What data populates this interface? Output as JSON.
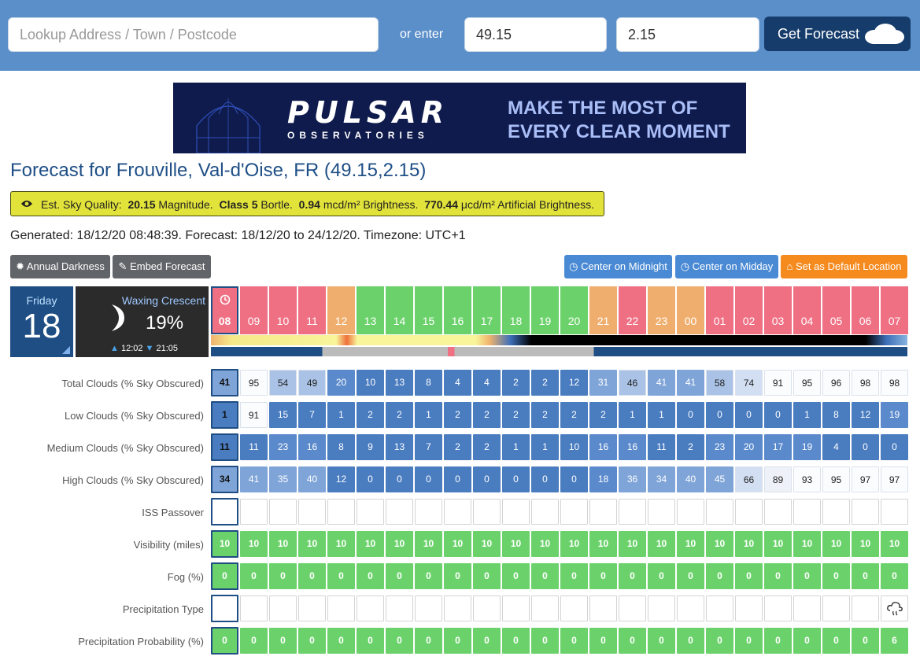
{
  "search": {
    "placeholder": "Lookup Address / Town / Postcode",
    "or_label": "or enter",
    "lat": "49.15",
    "lng": "2.15",
    "button_label": "Get Forecast"
  },
  "ad": {
    "brand": "PULSAR",
    "brand_sub": "OBSERVATORIES",
    "tagline_1": "MAKE THE MOST OF",
    "tagline_2": "EVERY CLEAR MOMENT"
  },
  "title": "Forecast for Frouville, Val-d'Oise, FR (49.15,2.15)",
  "sky_quality": {
    "label": "Est. Sky Quality:",
    "magnitude": "20.15",
    "magnitude_unit": "Magnitude.",
    "class": "Class 5",
    "bortle": "Bortle.",
    "brightness": "0.94",
    "brightness_unit": "mcd/m² Brightness.",
    "artificial": "770.44",
    "artificial_unit": "μcd/m² Artificial Brightness."
  },
  "generated": "Generated: 18/12/20 08:48:39. Forecast: 18/12/20 to 24/12/20. Timezone: UTC+1",
  "buttons": {
    "annual_darkness": "Annual Darkness",
    "embed": "Embed Forecast",
    "midnight": "Center on Midnight",
    "midday": "Center on Midday",
    "default_location": "Set as Default Location"
  },
  "day": {
    "name": "Friday",
    "date": "18"
  },
  "moon": {
    "phase": "Waxing Crescent",
    "illumination": "19%",
    "rise": "12:02",
    "set": "21:05"
  },
  "hours": [
    "08",
    "09",
    "10",
    "11",
    "12",
    "13",
    "14",
    "15",
    "16",
    "17",
    "18",
    "19",
    "20",
    "21",
    "22",
    "23",
    "00",
    "01",
    "02",
    "03",
    "04",
    "05",
    "06",
    "07"
  ],
  "hour_colors": [
    "#ef6f83",
    "#ef6f83",
    "#ef6f83",
    "#ef6f83",
    "#f0ae6e",
    "#6bd26b",
    "#6bd26b",
    "#6bd26b",
    "#6bd26b",
    "#6bd26b",
    "#6bd26b",
    "#6bd26b",
    "#6bd26b",
    "#f0ae6e",
    "#ef6f83",
    "#f0ae6e",
    "#f0ae6e",
    "#ef6f83",
    "#ef6f83",
    "#ef6f83",
    "#ef6f83",
    "#ef6f83",
    "#ef6f83",
    "#ef6f83"
  ],
  "rows": [
    {
      "label": "Total Clouds (% Sky Obscured)",
      "kind": "cloud",
      "first": "41",
      "values": [
        "95",
        "54",
        "49",
        "20",
        "10",
        "13",
        "8",
        "4",
        "4",
        "2",
        "2",
        "12",
        "31",
        "46",
        "41",
        "41",
        "58",
        "74",
        "91",
        "95",
        "96",
        "98",
        "98"
      ]
    },
    {
      "label": "Low Clouds (% Sky Obscured)",
      "kind": "cloud",
      "first": "1",
      "values": [
        "91",
        "15",
        "7",
        "1",
        "2",
        "2",
        "1",
        "2",
        "2",
        "2",
        "2",
        "2",
        "2",
        "1",
        "1",
        "0",
        "0",
        "0",
        "0",
        "1",
        "8",
        "12",
        "19"
      ]
    },
    {
      "label": "Medium Clouds (% Sky Obscured)",
      "kind": "cloud",
      "first": "11",
      "values": [
        "11",
        "23",
        "16",
        "8",
        "9",
        "13",
        "7",
        "2",
        "2",
        "1",
        "1",
        "10",
        "16",
        "16",
        "11",
        "2",
        "23",
        "20",
        "17",
        "19",
        "4",
        "0",
        "0"
      ]
    },
    {
      "label": "High Clouds (% Sky Obscured)",
      "kind": "cloud",
      "first": "34",
      "values": [
        "41",
        "35",
        "40",
        "12",
        "0",
        "0",
        "0",
        "0",
        "0",
        "0",
        "0",
        "0",
        "18",
        "36",
        "34",
        "40",
        "45",
        "66",
        "89",
        "93",
        "95",
        "97",
        "97"
      ]
    },
    {
      "label": "ISS Passover",
      "kind": "empty",
      "first": "",
      "values": [
        "",
        "",
        "",
        "",
        "",
        "",
        "",
        "",
        "",
        "",
        "",
        "",
        "",
        "",
        "",
        "",
        "",
        "",
        "",
        "",
        "",
        "",
        ""
      ]
    },
    {
      "label": "Visibility (miles)",
      "kind": "green",
      "first": "10",
      "values": [
        "10",
        "10",
        "10",
        "10",
        "10",
        "10",
        "10",
        "10",
        "10",
        "10",
        "10",
        "10",
        "10",
        "10",
        "10",
        "10",
        "10",
        "10",
        "10",
        "10",
        "10",
        "10",
        "10"
      ]
    },
    {
      "label": "Fog (%)",
      "kind": "green",
      "first": "0",
      "values": [
        "0",
        "0",
        "0",
        "0",
        "0",
        "0",
        "0",
        "0",
        "0",
        "0",
        "0",
        "0",
        "0",
        "0",
        "0",
        "0",
        "0",
        "0",
        "0",
        "0",
        "0",
        "0",
        "0"
      ]
    },
    {
      "label": "Precipitation Type",
      "kind": "empty",
      "first": "",
      "values": [
        "",
        "",
        "",
        "",
        "",
        "",
        "",
        "",
        "",
        "",
        "",
        "",
        "",
        "",
        "",
        "",
        "",
        "",
        "",
        "",
        "",
        "",
        ""
      ],
      "last_icon": "rain-cloud-icon"
    },
    {
      "label": "Precipitation Probability (%)",
      "kind": "green",
      "first": "0",
      "values": [
        "0",
        "0",
        "0",
        "0",
        "0",
        "0",
        "0",
        "0",
        "0",
        "0",
        "0",
        "0",
        "0",
        "0",
        "0",
        "0",
        "0",
        "0",
        "0",
        "0",
        "0",
        "0",
        "6"
      ]
    }
  ],
  "colors": {
    "topbar": "#5b8fc9",
    "dark_blue": "#1e4e84",
    "sky_yellow": "#e2e33a",
    "green": "#6bd26b",
    "orange": "#f58a1f"
  }
}
